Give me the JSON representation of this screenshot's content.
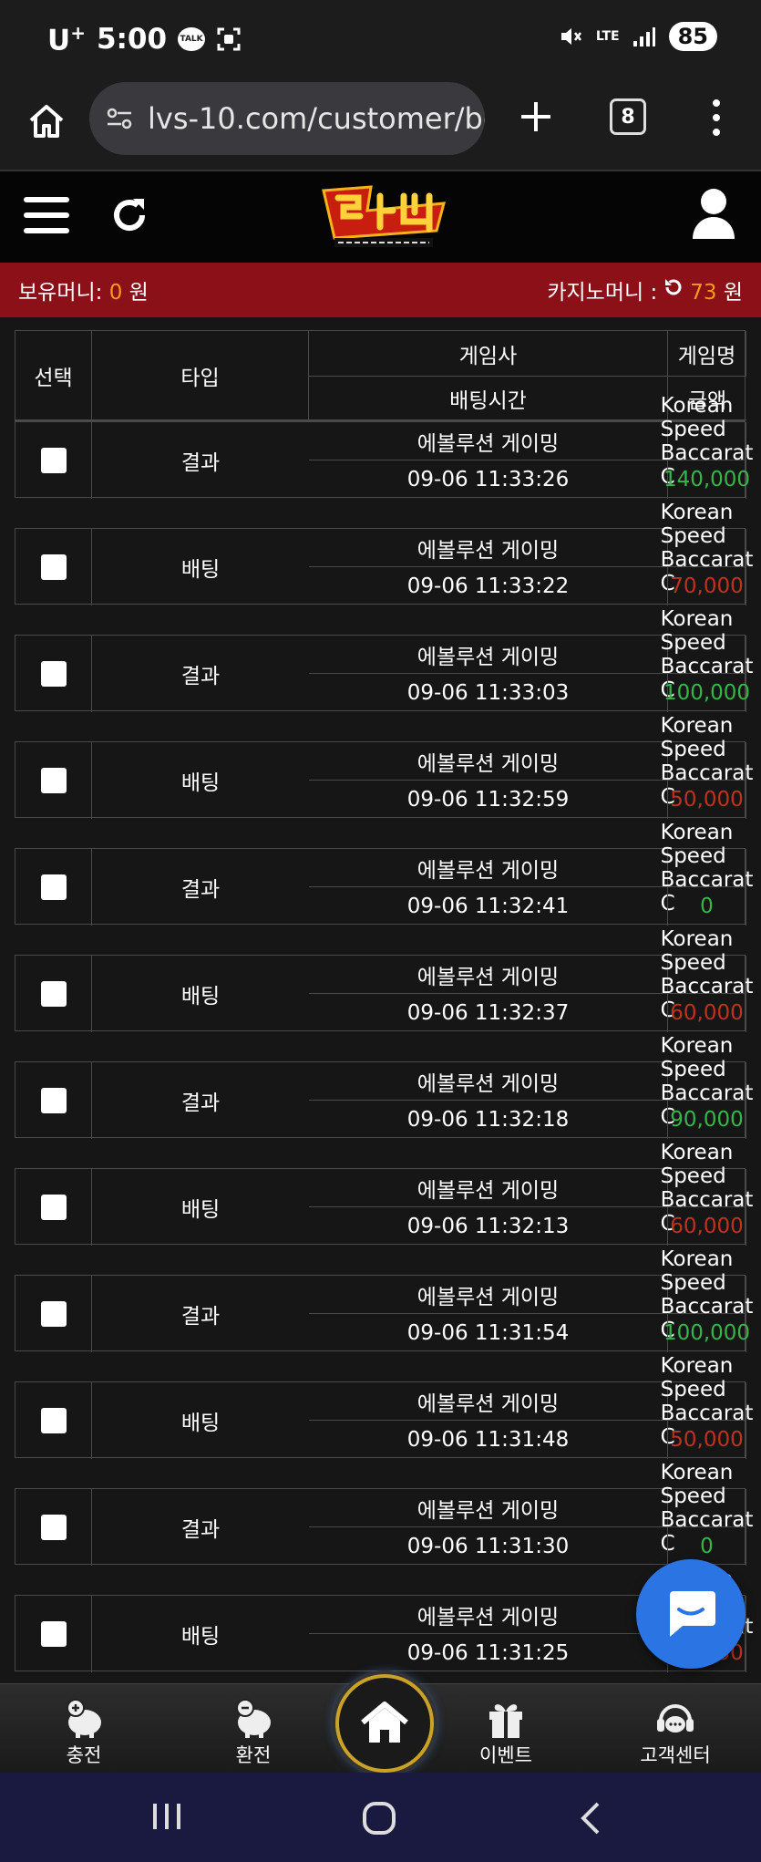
{
  "status_bar": {
    "carrier": "U",
    "carrier_sup": "+",
    "time": "5:00",
    "talk": "TALK",
    "network": "LTE",
    "battery": "85"
  },
  "browser": {
    "url": "lvs-10.com/customer/be",
    "tab_count": "8"
  },
  "money_bar": {
    "holding_label": "보유머니: ",
    "holding_value": "0",
    "holding_unit": " 원",
    "casino_label": "카지노머니 : ",
    "casino_value": "73",
    "casino_unit": " 원"
  },
  "table_header": {
    "select": "선택",
    "provider": "게임사",
    "game_name": "게임명",
    "type": "타입",
    "bet_time": "배팅시간",
    "amount": "금액"
  },
  "records": [
    {
      "provider": "에볼루션 게이밍",
      "game": "Korean Speed Baccarat C",
      "time": "09-06 11:33:26",
      "amount": "140,000",
      "type": "결과",
      "tone": "win"
    },
    {
      "provider": "에볼루션 게이밍",
      "game": "Korean Speed Baccarat C",
      "time": "09-06 11:33:22",
      "amount": "70,000",
      "type": "배팅",
      "tone": "lose"
    },
    {
      "provider": "에볼루션 게이밍",
      "game": "Korean Speed Baccarat C",
      "time": "09-06 11:33:03",
      "amount": "100,000",
      "type": "결과",
      "tone": "win"
    },
    {
      "provider": "에볼루션 게이밍",
      "game": "Korean Speed Baccarat C",
      "time": "09-06 11:32:59",
      "amount": "50,000",
      "type": "배팅",
      "tone": "lose"
    },
    {
      "provider": "에볼루션 게이밍",
      "game": "Korean Speed Baccarat C",
      "time": "09-06 11:32:41",
      "amount": "0",
      "type": "결과",
      "tone": "zero"
    },
    {
      "provider": "에볼루션 게이밍",
      "game": "Korean Speed Baccarat C",
      "time": "09-06 11:32:37",
      "amount": "60,000",
      "type": "배팅",
      "tone": "lose"
    },
    {
      "provider": "에볼루션 게이밍",
      "game": "Korean Speed Baccarat C",
      "time": "09-06 11:32:18",
      "amount": "90,000",
      "type": "결과",
      "tone": "win"
    },
    {
      "provider": "에볼루션 게이밍",
      "game": "Korean Speed Baccarat C",
      "time": "09-06 11:32:13",
      "amount": "60,000",
      "type": "배팅",
      "tone": "lose"
    },
    {
      "provider": "에볼루션 게이밍",
      "game": "Korean Speed Baccarat C",
      "time": "09-06 11:31:54",
      "amount": "100,000",
      "type": "결과",
      "tone": "win"
    },
    {
      "provider": "에볼루션 게이밍",
      "game": "Korean Speed Baccarat C",
      "time": "09-06 11:31:48",
      "amount": "50,000",
      "type": "배팅",
      "tone": "lose"
    },
    {
      "provider": "에볼루션 게이밍",
      "game": "Korean Speed Baccarat C",
      "time": "09-06 11:31:30",
      "amount": "0",
      "type": "결과",
      "tone": "zero"
    },
    {
      "provider": "에볼루션 게이밍",
      "game": "Korean Speed Baccarat C",
      "time": "09-06 11:31:25",
      "amount": "70,000",
      "type": "배팅",
      "tone": "lose"
    }
  ],
  "bottom_nav": {
    "deposit": "충전",
    "withdraw": "환전",
    "event": "이벤트",
    "support": "고객센터"
  },
  "colors": {
    "win": "#35b648",
    "lose": "#c0311e",
    "accent_orange": "#f59a1f",
    "money_bar_bg": "#8b1017"
  }
}
